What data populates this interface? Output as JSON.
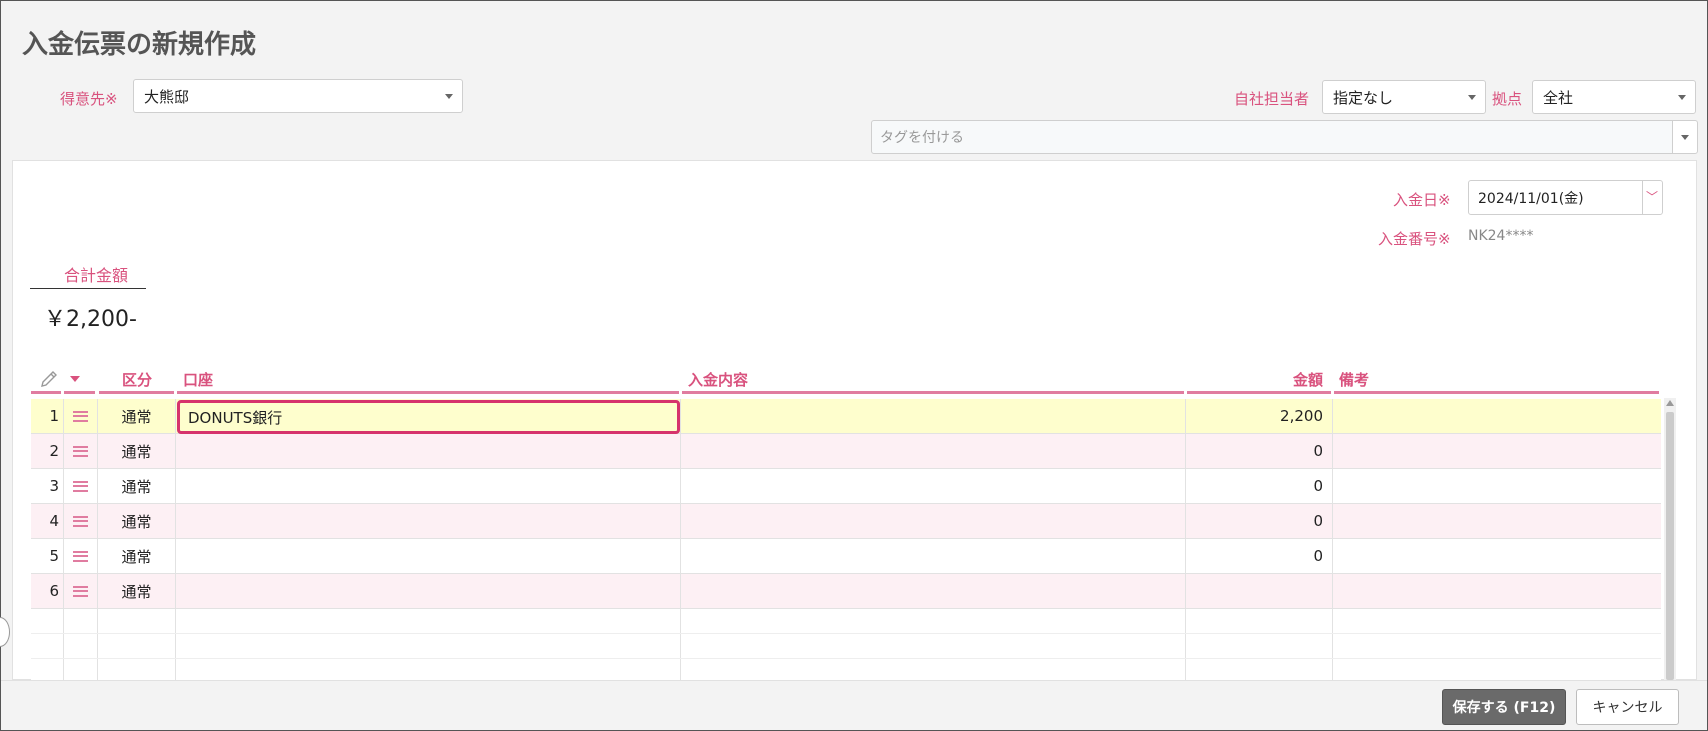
{
  "page": {
    "title": "入金伝票の新規作成"
  },
  "customer": {
    "label": "得意先",
    "required_mark": "※",
    "value": "大熊邸"
  },
  "staff": {
    "label": "自社担当者",
    "value": "指定なし"
  },
  "branch": {
    "label": "拠点",
    "value": "全社"
  },
  "tags": {
    "placeholder": "タグを付ける"
  },
  "deposit_date": {
    "label": "入金日",
    "required_mark": "※",
    "value": "2024/11/01(金)"
  },
  "deposit_no": {
    "label": "入金番号",
    "required_mark": "※",
    "value": "NK24****"
  },
  "total": {
    "label": "合計金額",
    "value": "￥2,200-"
  },
  "grid": {
    "headers": {
      "kubun": "区分",
      "koza": "口座",
      "naiyo": "入金内容",
      "kingaku": "金額",
      "biko": "備考"
    },
    "rows": [
      {
        "no": "1",
        "kubun": "通常",
        "koza": "DONUTS銀行",
        "naiyo": "",
        "kingaku": "2,200",
        "biko": ""
      },
      {
        "no": "2",
        "kubun": "通常",
        "koza": "",
        "naiyo": "",
        "kingaku": "0",
        "biko": ""
      },
      {
        "no": "3",
        "kubun": "通常",
        "koza": "",
        "naiyo": "",
        "kingaku": "0",
        "biko": ""
      },
      {
        "no": "4",
        "kubun": "通常",
        "koza": "",
        "naiyo": "",
        "kingaku": "0",
        "biko": ""
      },
      {
        "no": "5",
        "kubun": "通常",
        "koza": "",
        "naiyo": "",
        "kingaku": "0",
        "biko": ""
      },
      {
        "no": "6",
        "kubun": "通常",
        "koza": "",
        "naiyo": "",
        "kingaku": "",
        "biko": ""
      }
    ]
  },
  "footer": {
    "save_label": "保存する (F12)",
    "cancel_label": "キャンセル"
  },
  "colors": {
    "accent_pink": "#d9527e",
    "focus_border": "#d6336c",
    "selected_row": "#fefecd",
    "stripe_row": "#fdf0f4"
  }
}
